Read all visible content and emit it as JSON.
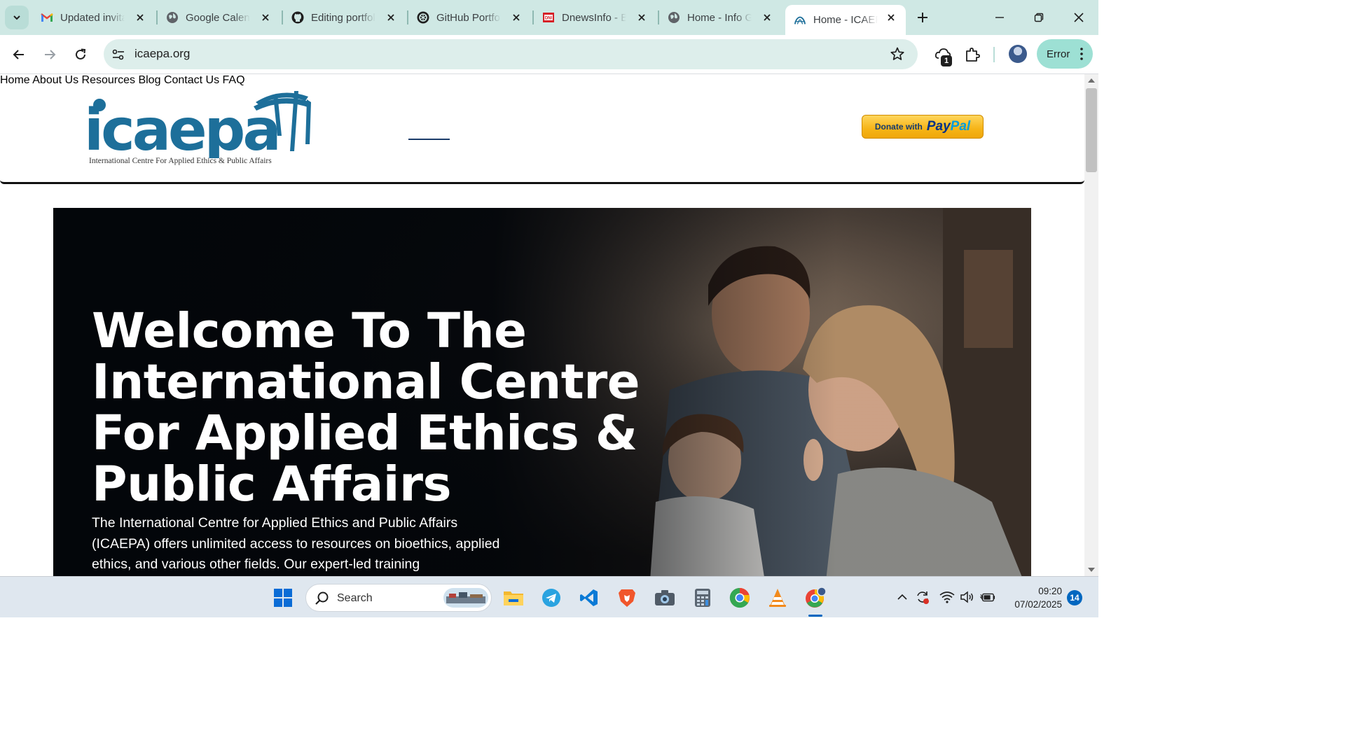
{
  "browser": {
    "tabs": [
      {
        "title": "Updated invitation",
        "favicon": "gmail-icon"
      },
      {
        "title": "Google Calendar",
        "favicon": "globe-icon"
      },
      {
        "title": "Editing portfolio",
        "favicon": "github-icon"
      },
      {
        "title": "GitHub Portfolio",
        "favicon": "openai-icon"
      },
      {
        "title": "DnewsInfo - B",
        "favicon": "dnews-icon"
      },
      {
        "title": "Home - Info G",
        "favicon": "globe-icon"
      },
      {
        "title": "Home - ICAEPA",
        "favicon": "icaepa-icon",
        "active": true
      }
    ],
    "address": "icaepa.org",
    "extension_badge": "1",
    "profile_status": "Error"
  },
  "site": {
    "logo_text": "icaepa",
    "logo_tagline": "International Centre For Applied Ethics & Public Affairs",
    "nav": [
      "Home",
      "About Us",
      "Resources",
      "Blog",
      "Contact Us",
      "FAQ"
    ],
    "nav_active": "Home",
    "donate": {
      "prefix": "Donate with",
      "brand_a": "Pay",
      "brand_b": "Pal"
    },
    "hero": {
      "title": "Welcome To The International Centre For Applied Ethics & Public Affairs",
      "text": "The International Centre for Applied Ethics and Public Affairs (ICAEPA) offers unlimited access to resources on bioethics, applied ethics, and various other fields. Our expert-led training"
    },
    "colors": {
      "navy": "#0e2a4a",
      "logo_blue": "#1d6f9a",
      "hero_bg": "#070a0f",
      "paypal_gold": "#f6b417"
    }
  },
  "taskbar": {
    "search_placeholder": "Search",
    "time": "09:20",
    "date": "07/02/2025",
    "notifications": "14"
  }
}
